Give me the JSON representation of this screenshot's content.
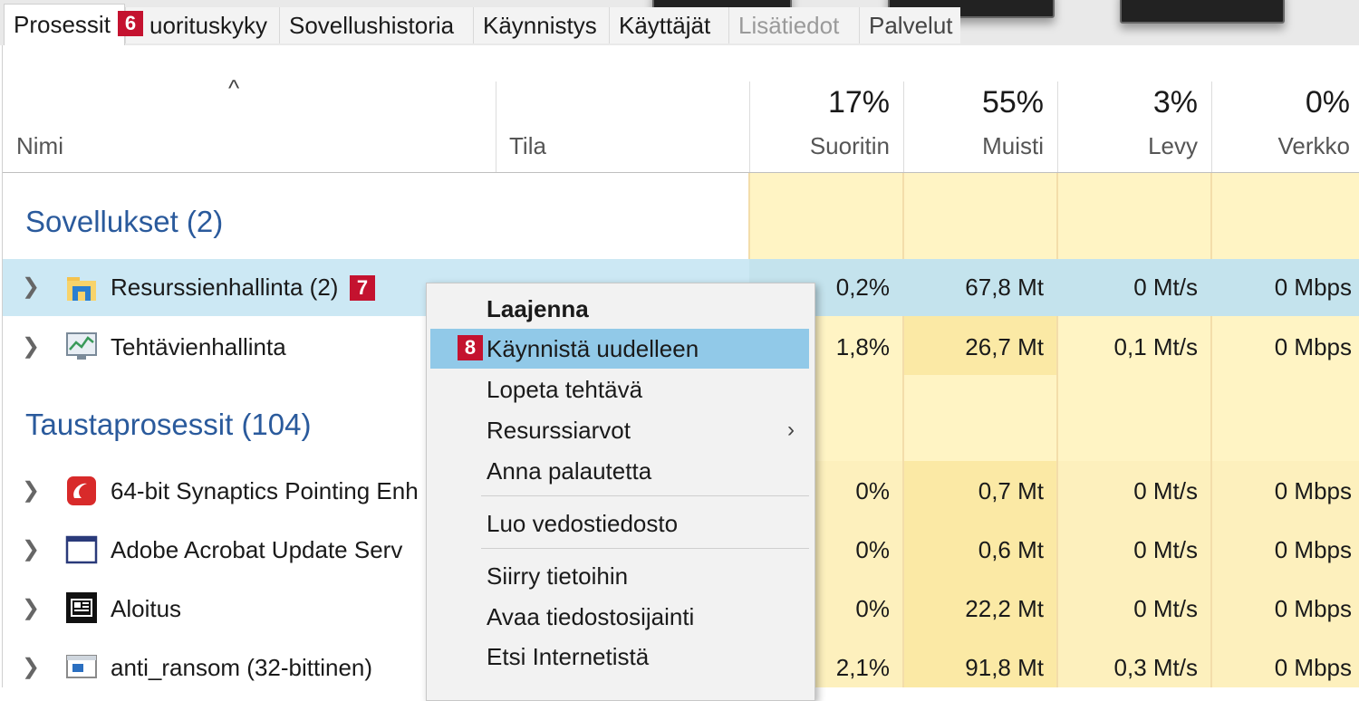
{
  "tabs": [
    {
      "label": "Prosessit",
      "active": true
    },
    {
      "label": "uorituskyky"
    },
    {
      "label": "Sovellushistoria"
    },
    {
      "label": "Käynnistys"
    },
    {
      "label": "Käyttäjät"
    },
    {
      "label": "Lisätiedot"
    },
    {
      "label": "Palvelut"
    }
  ],
  "badges": {
    "b6": "6",
    "b7": "7",
    "b8": "8"
  },
  "header": {
    "caret": "^",
    "name": "Nimi",
    "status": "Tila",
    "cpu": {
      "pct": "17%",
      "label": "Suoritin"
    },
    "mem": {
      "pct": "55%",
      "label": "Muisti"
    },
    "disk": {
      "pct": "3%",
      "label": "Levy"
    },
    "net": {
      "pct": "0%",
      "label": "Verkko"
    }
  },
  "groups": {
    "apps": "Sovellukset (2)",
    "background": "Taustaprosessit (104)"
  },
  "rows": [
    {
      "name": "Resurssienhallinta (2)",
      "cpu": "0,2%",
      "mem": "67,8 Mt",
      "disk": "0 Mt/s",
      "net": "0 Mbps",
      "icon": "folder-icon"
    },
    {
      "name": "Tehtävienhallinta",
      "cpu": "1,8%",
      "mem": "26,7 Mt",
      "disk": "0,1 Mt/s",
      "net": "0 Mbps",
      "icon": "task-manager-icon"
    },
    {
      "name": "64-bit Synaptics Pointing Enh",
      "cpu": "0%",
      "mem": "0,7 Mt",
      "disk": "0 Mt/s",
      "net": "0 Mbps",
      "icon": "synaptics-icon"
    },
    {
      "name": "Adobe Acrobat Update Serv",
      "cpu": "0%",
      "mem": "0,6 Mt",
      "disk": "0 Mt/s",
      "net": "0 Mbps",
      "icon": "window-icon"
    },
    {
      "name": "Aloitus",
      "cpu": "0%",
      "mem": "22,2 Mt",
      "disk": "0 Mt/s",
      "net": "0 Mbps",
      "icon": "start-icon"
    },
    {
      "name": "anti_ransom (32-bittinen)",
      "cpu": "2,1%",
      "mem": "91,8 Mt",
      "disk": "0,3 Mt/s",
      "net": "0 Mbps",
      "icon": "app-window-icon"
    }
  ],
  "context_menu": {
    "expand": "Laajenna",
    "restart": "Käynnistä uudelleen",
    "end_task": "Lopeta tehtävä",
    "resource_values": "Resurssiarvot",
    "feedback": "Anna palautetta",
    "dump": "Luo vedostiedosto",
    "details": "Siirry tietoihin",
    "open_location": "Avaa tiedostosijainti",
    "search_web": "Etsi Internetistä",
    "submenu_arrow": "›"
  },
  "colors": {
    "group_title": "#2a5a9c",
    "selection": "#cce8f4",
    "menu_highlight": "#91c9e8",
    "heat_low": "#fff4c4",
    "heat_mid": "#fbe9a5",
    "badge": "#c4122f"
  }
}
